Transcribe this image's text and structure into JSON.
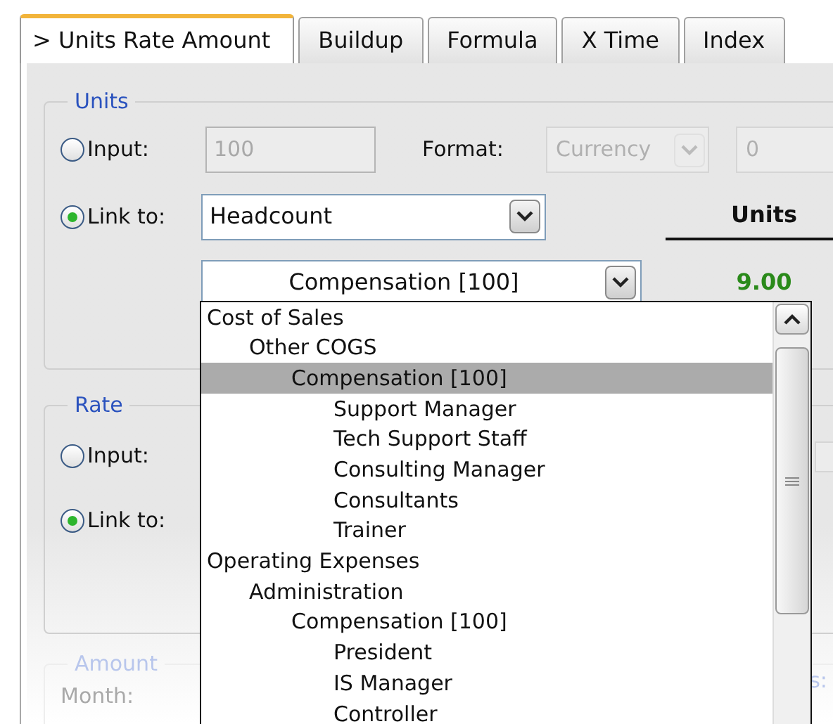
{
  "tabs": [
    {
      "label": "> Units Rate Amount",
      "selected": true
    },
    {
      "label": "Buildup",
      "selected": false
    },
    {
      "label": "Formula",
      "selected": false
    },
    {
      "label": "X Time",
      "selected": false
    },
    {
      "label": "Index",
      "selected": false
    }
  ],
  "units": {
    "legend": "Units",
    "input": {
      "label": "Input:",
      "selected": false,
      "value": "100",
      "disabled": true
    },
    "format": {
      "label": "Format:",
      "value": "Currency",
      "digits": "0",
      "disabled": true
    },
    "link": {
      "label": "Link to:",
      "selected": true,
      "value": "Headcount"
    },
    "sub_link": {
      "value": "Compensation [100]"
    },
    "column_header": "Units",
    "result": "9.00"
  },
  "rate": {
    "legend": "Rate",
    "input": {
      "label": "Input:",
      "selected": false
    },
    "link": {
      "label": "Link to:",
      "selected": true
    }
  },
  "amount": {
    "legend": "Amount",
    "month_label": "Month:",
    "column_2": "s:"
  },
  "dropdown": {
    "items": [
      {
        "label": "Cost of Sales",
        "selected": false,
        "children": [
          {
            "label": "Other COGS",
            "selected": false,
            "children": [
              {
                "label": "Compensation [100]",
                "selected": true,
                "children": [
                  {
                    "label": "Support Manager",
                    "selected": false
                  },
                  {
                    "label": "Tech Support Staff",
                    "selected": false
                  },
                  {
                    "label": "Consulting Manager",
                    "selected": false
                  },
                  {
                    "label": "Consultants",
                    "selected": false
                  },
                  {
                    "label": "Trainer",
                    "selected": false
                  }
                ]
              }
            ]
          }
        ]
      },
      {
        "label": "Operating Expenses",
        "selected": false,
        "children": [
          {
            "label": "Administration",
            "selected": false,
            "children": [
              {
                "label": "Compensation [100]",
                "selected": false,
                "children": [
                  {
                    "label": "President",
                    "selected": false
                  },
                  {
                    "label": "IS Manager",
                    "selected": false
                  },
                  {
                    "label": "Controller",
                    "selected": false
                  }
                ]
              }
            ]
          }
        ]
      }
    ]
  }
}
